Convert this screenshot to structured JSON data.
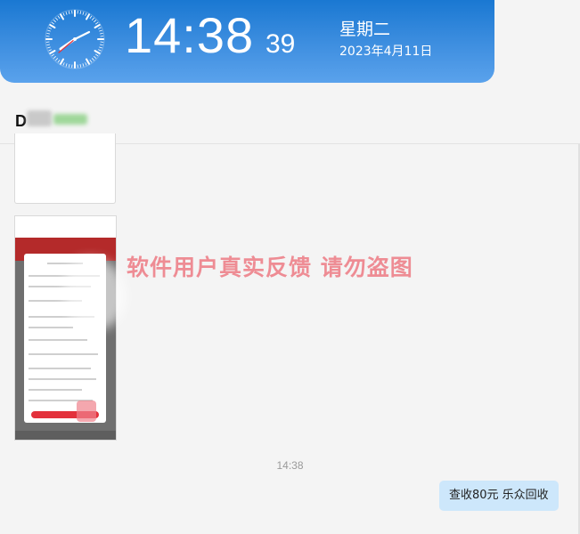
{
  "clock": {
    "time_hm": "14:38",
    "seconds": "39",
    "weekday": "星期二",
    "date": "2023年4月11日"
  },
  "chat": {
    "name_initial": "D",
    "name_suffix_blurred": "微信",
    "timestamp": "14:38",
    "watermark": "软件用户真实反馈  请勿盗图",
    "outgoing_message": "查收80元  乐众回收"
  },
  "colors": {
    "banner": "#2f84da",
    "bubble": "#cde7fb",
    "watermark": "#ec6e78"
  }
}
